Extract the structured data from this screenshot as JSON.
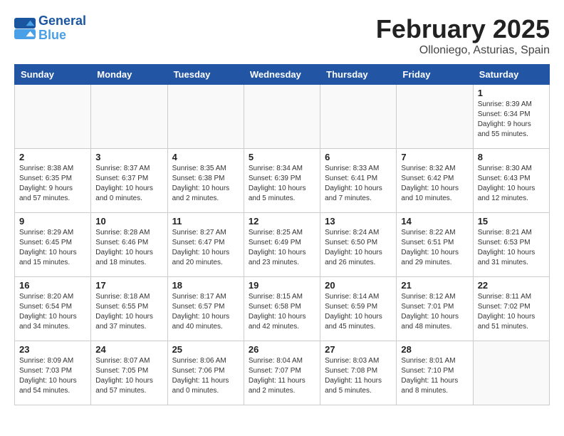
{
  "header": {
    "logo_line1": "General",
    "logo_line2": "Blue",
    "month_title": "February 2025",
    "location": "Olloniego, Asturias, Spain"
  },
  "days_of_week": [
    "Sunday",
    "Monday",
    "Tuesday",
    "Wednesday",
    "Thursday",
    "Friday",
    "Saturday"
  ],
  "weeks": [
    [
      {
        "day": "",
        "info": ""
      },
      {
        "day": "",
        "info": ""
      },
      {
        "day": "",
        "info": ""
      },
      {
        "day": "",
        "info": ""
      },
      {
        "day": "",
        "info": ""
      },
      {
        "day": "",
        "info": ""
      },
      {
        "day": "1",
        "info": "Sunrise: 8:39 AM\nSunset: 6:34 PM\nDaylight: 9 hours\nand 55 minutes."
      }
    ],
    [
      {
        "day": "2",
        "info": "Sunrise: 8:38 AM\nSunset: 6:35 PM\nDaylight: 9 hours\nand 57 minutes."
      },
      {
        "day": "3",
        "info": "Sunrise: 8:37 AM\nSunset: 6:37 PM\nDaylight: 10 hours\nand 0 minutes."
      },
      {
        "day": "4",
        "info": "Sunrise: 8:35 AM\nSunset: 6:38 PM\nDaylight: 10 hours\nand 2 minutes."
      },
      {
        "day": "5",
        "info": "Sunrise: 8:34 AM\nSunset: 6:39 PM\nDaylight: 10 hours\nand 5 minutes."
      },
      {
        "day": "6",
        "info": "Sunrise: 8:33 AM\nSunset: 6:41 PM\nDaylight: 10 hours\nand 7 minutes."
      },
      {
        "day": "7",
        "info": "Sunrise: 8:32 AM\nSunset: 6:42 PM\nDaylight: 10 hours\nand 10 minutes."
      },
      {
        "day": "8",
        "info": "Sunrise: 8:30 AM\nSunset: 6:43 PM\nDaylight: 10 hours\nand 12 minutes."
      }
    ],
    [
      {
        "day": "9",
        "info": "Sunrise: 8:29 AM\nSunset: 6:45 PM\nDaylight: 10 hours\nand 15 minutes."
      },
      {
        "day": "10",
        "info": "Sunrise: 8:28 AM\nSunset: 6:46 PM\nDaylight: 10 hours\nand 18 minutes."
      },
      {
        "day": "11",
        "info": "Sunrise: 8:27 AM\nSunset: 6:47 PM\nDaylight: 10 hours\nand 20 minutes."
      },
      {
        "day": "12",
        "info": "Sunrise: 8:25 AM\nSunset: 6:49 PM\nDaylight: 10 hours\nand 23 minutes."
      },
      {
        "day": "13",
        "info": "Sunrise: 8:24 AM\nSunset: 6:50 PM\nDaylight: 10 hours\nand 26 minutes."
      },
      {
        "day": "14",
        "info": "Sunrise: 8:22 AM\nSunset: 6:51 PM\nDaylight: 10 hours\nand 29 minutes."
      },
      {
        "day": "15",
        "info": "Sunrise: 8:21 AM\nSunset: 6:53 PM\nDaylight: 10 hours\nand 31 minutes."
      }
    ],
    [
      {
        "day": "16",
        "info": "Sunrise: 8:20 AM\nSunset: 6:54 PM\nDaylight: 10 hours\nand 34 minutes."
      },
      {
        "day": "17",
        "info": "Sunrise: 8:18 AM\nSunset: 6:55 PM\nDaylight: 10 hours\nand 37 minutes."
      },
      {
        "day": "18",
        "info": "Sunrise: 8:17 AM\nSunset: 6:57 PM\nDaylight: 10 hours\nand 40 minutes."
      },
      {
        "day": "19",
        "info": "Sunrise: 8:15 AM\nSunset: 6:58 PM\nDaylight: 10 hours\nand 42 minutes."
      },
      {
        "day": "20",
        "info": "Sunrise: 8:14 AM\nSunset: 6:59 PM\nDaylight: 10 hours\nand 45 minutes."
      },
      {
        "day": "21",
        "info": "Sunrise: 8:12 AM\nSunset: 7:01 PM\nDaylight: 10 hours\nand 48 minutes."
      },
      {
        "day": "22",
        "info": "Sunrise: 8:11 AM\nSunset: 7:02 PM\nDaylight: 10 hours\nand 51 minutes."
      }
    ],
    [
      {
        "day": "23",
        "info": "Sunrise: 8:09 AM\nSunset: 7:03 PM\nDaylight: 10 hours\nand 54 minutes."
      },
      {
        "day": "24",
        "info": "Sunrise: 8:07 AM\nSunset: 7:05 PM\nDaylight: 10 hours\nand 57 minutes."
      },
      {
        "day": "25",
        "info": "Sunrise: 8:06 AM\nSunset: 7:06 PM\nDaylight: 11 hours\nand 0 minutes."
      },
      {
        "day": "26",
        "info": "Sunrise: 8:04 AM\nSunset: 7:07 PM\nDaylight: 11 hours\nand 2 minutes."
      },
      {
        "day": "27",
        "info": "Sunrise: 8:03 AM\nSunset: 7:08 PM\nDaylight: 11 hours\nand 5 minutes."
      },
      {
        "day": "28",
        "info": "Sunrise: 8:01 AM\nSunset: 7:10 PM\nDaylight: 11 hours\nand 8 minutes."
      },
      {
        "day": "",
        "info": ""
      }
    ]
  ]
}
